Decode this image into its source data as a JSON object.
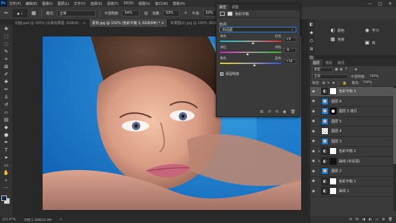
{
  "menubar": {
    "logo": "Ps",
    "items": [
      "文件(F)",
      "编辑(E)",
      "图像(I)",
      "图层(L)",
      "文字(Y)",
      "选择(S)",
      "滤镜(T)",
      "3D(D)",
      "视图(V)",
      "窗口(W)",
      "帮助(H)"
    ],
    "controls": [
      "—",
      "□",
      "✕"
    ]
  },
  "options": {
    "mode_label": "模式:",
    "mode_value": "正常",
    "opacity_label": "不透明度:",
    "opacity_value": "54%",
    "flow_label": "流量:",
    "flow_value": "53%",
    "smooth_label": "平滑:",
    "smooth_value": "10%",
    "brush_size": "1"
  },
  "tabs": [
    {
      "label": "封面.psd @ 100% (头像效果图, RGB/8)... ×",
      "active": false
    },
    {
      "label": "素材.jpg @ 102% (色彩平衡 3, RGB/8#) * ×",
      "active": true
    },
    {
      "label": "效果图(2).jpg @ 100% (RGB/8)... ×",
      "active": false
    }
  ],
  "toolbar": {
    "tools": [
      {
        "name": "move-tool-icon",
        "glyph": "✥"
      },
      {
        "name": "marquee-tool-icon",
        "glyph": "⬚"
      },
      {
        "name": "lasso-tool-icon",
        "glyph": "◌"
      },
      {
        "name": "quick-select-tool-icon",
        "glyph": "✎"
      },
      {
        "name": "crop-tool-icon",
        "glyph": "⌗"
      },
      {
        "name": "frame-tool-icon",
        "glyph": "⊠"
      },
      {
        "name": "eyedropper-tool-icon",
        "glyph": "✐"
      },
      {
        "name": "healing-tool-icon",
        "glyph": "✚"
      },
      {
        "name": "brush-tool-icon",
        "glyph": "✏"
      },
      {
        "name": "stamp-tool-icon",
        "glyph": "♙"
      },
      {
        "name": "history-brush-tool-icon",
        "glyph": "↺"
      },
      {
        "name": "eraser-tool-icon",
        "glyph": "▱"
      },
      {
        "name": "gradient-tool-icon",
        "glyph": "▤"
      },
      {
        "name": "blur-tool-icon",
        "glyph": "◆"
      },
      {
        "name": "dodge-tool-icon",
        "glyph": "●"
      },
      {
        "name": "pen-tool-icon",
        "glyph": "✒"
      },
      {
        "name": "type-tool-icon",
        "glyph": "T"
      },
      {
        "name": "path-select-tool-icon",
        "glyph": "➤"
      },
      {
        "name": "shape-tool-icon",
        "glyph": "▭"
      },
      {
        "name": "hand-tool-icon",
        "glyph": "✋"
      },
      {
        "name": "zoom-tool-icon",
        "glyph": "⌕"
      },
      {
        "name": "more-tools-icon",
        "glyph": "···"
      }
    ]
  },
  "status": {
    "zoom": "101.67%",
    "doc": "文档:1.38M/14.9M",
    "arrow": ">"
  },
  "properties": {
    "tabs": [
      {
        "label": "属性",
        "active": true
      },
      {
        "label": "调整",
        "active": false
      }
    ],
    "title": "色彩平衡",
    "tone_label": "色调:",
    "tone_value": "中间调",
    "sliders": [
      {
        "left": "青色",
        "right": "红色",
        "value": "+9",
        "pos": 0.545,
        "gradient": "linear-gradient(90deg,#00c8d6,#9aa7a8,#e0302c)"
      },
      {
        "left": "洋红",
        "right": "绿色",
        "value": "-9",
        "pos": 0.455,
        "gradient": "linear-gradient(90deg,#e020c8,#9d9d9d,#30c030)"
      },
      {
        "left": "黄色",
        "right": "蓝色",
        "value": "+14",
        "pos": 0.57,
        "gradient": "linear-gradient(90deg,#e8d820,#a8a8a8,#3050e0)"
      }
    ],
    "luminosity_label": "保留明度",
    "footer_icons": [
      "⊞",
      "↺",
      "⟲",
      "◉",
      "🗑"
    ]
  },
  "right_icons": {
    "items": [
      {
        "name": "learn-icon",
        "glyph": "◉",
        "label": "学习"
      },
      {
        "name": "color-icon",
        "glyph": "◐",
        "label": "颜色"
      },
      {
        "name": "swatches-icon",
        "glyph": "▦",
        "label": "色板"
      },
      {
        "name": "library-icon",
        "glyph": "▣",
        "label": "库"
      }
    ],
    "side": [
      "◧",
      "◆",
      "⌬",
      "⊞",
      "▥",
      "A",
      "¶",
      "◎",
      "▤"
    ]
  },
  "layers": {
    "tabs": [
      {
        "label": "图层",
        "active": true
      },
      {
        "label": "通道",
        "active": false
      },
      {
        "label": "路径",
        "active": false
      }
    ],
    "kind_label": "类型",
    "filter_icons": [
      "▣",
      "◐",
      "T",
      "⬚",
      "◈"
    ],
    "blend_mode": "正常",
    "opacity_label": "不透明度:",
    "opacity_value": "100%",
    "lock_label": "锁定:",
    "lock_icons": [
      "⊠",
      "✎",
      "✥",
      "⬚",
      "🔒"
    ],
    "fill_label": "填充:",
    "fill_value": "100%",
    "items": [
      {
        "name": "色彩平衡 3",
        "type": "adj",
        "selected": true,
        "clip": false
      },
      {
        "name": "图层 6",
        "type": "face",
        "selected": false,
        "clip": false
      },
      {
        "name": "图层 5 拷贝",
        "type": "face-mask",
        "selected": false,
        "clip": false
      },
      {
        "name": "图层 5",
        "type": "face",
        "selected": false,
        "clip": false
      },
      {
        "name": "图层 4",
        "type": "checker",
        "selected": false,
        "clip": false
      },
      {
        "name": "图层 3",
        "type": "face",
        "selected": false,
        "clip": false
      },
      {
        "name": "色彩平衡 2",
        "type": "adj",
        "selected": false,
        "clip": true
      },
      {
        "name": "曲线 (中间调)",
        "type": "adj-black",
        "selected": false,
        "clip": true
      },
      {
        "name": "图层 2",
        "type": "face",
        "selected": false,
        "clip": false
      },
      {
        "name": "色彩平衡 1",
        "type": "adj",
        "selected": false,
        "clip": false
      },
      {
        "name": "曲线 1",
        "type": "adj",
        "selected": false,
        "clip": false
      }
    ],
    "footer_icons": [
      "⊖",
      "fx",
      "◑",
      "◐",
      "▭",
      "⊞",
      "🗑"
    ]
  }
}
